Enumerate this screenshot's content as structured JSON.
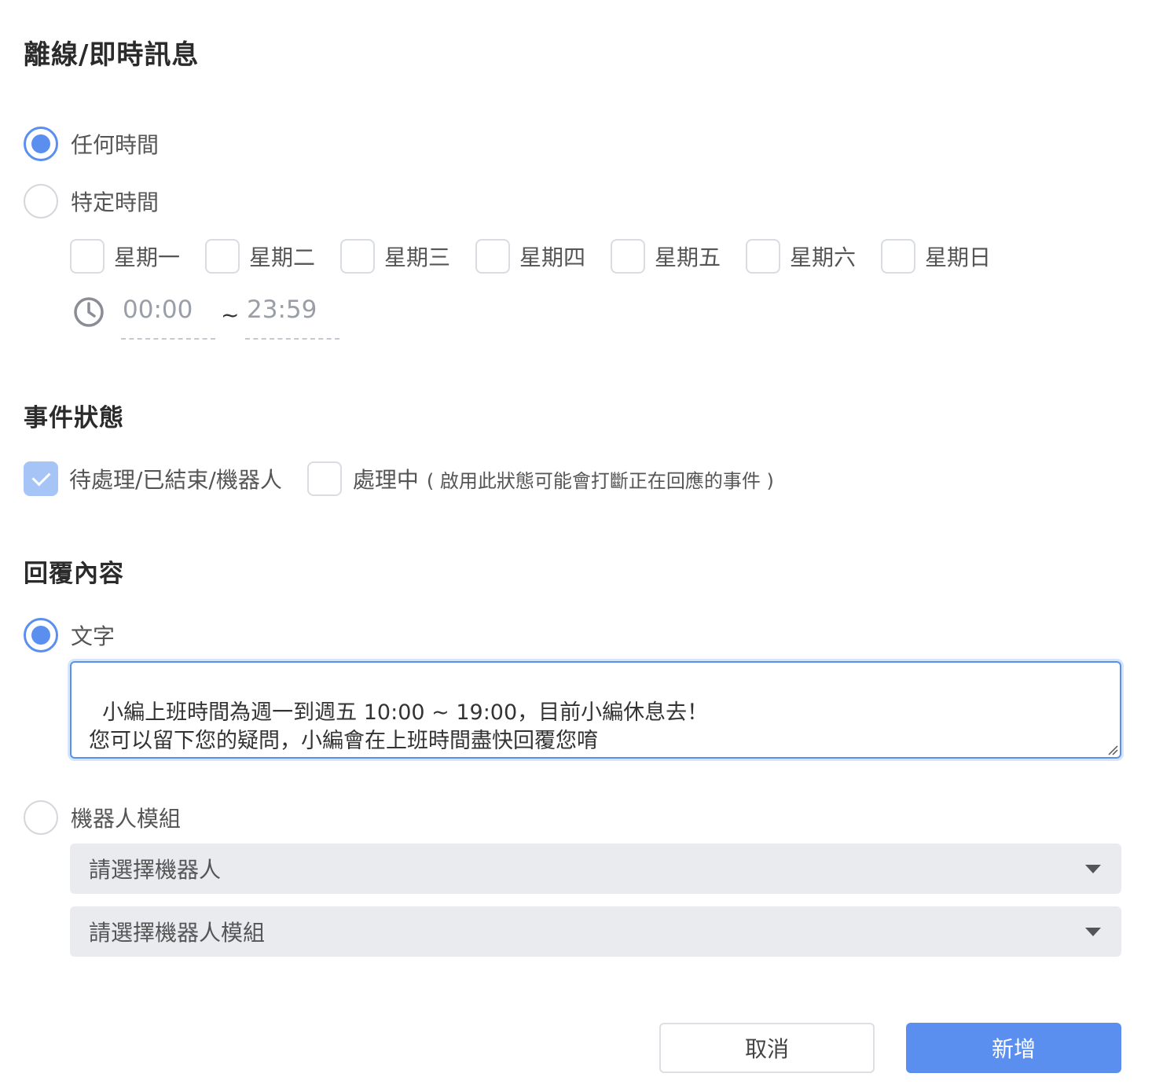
{
  "title": "離線/即時訊息",
  "schedule": {
    "any_time_label": "任何時間",
    "specific_time_label": "特定時間",
    "days": [
      "星期一",
      "星期二",
      "星期三",
      "星期四",
      "星期五",
      "星期六",
      "星期日"
    ],
    "start_time": "00:00",
    "separator": "~",
    "end_time": "23:59"
  },
  "event_status": {
    "heading": "事件狀態",
    "option1_label": "待處理/已結束/機器人",
    "option2_label": "處理中",
    "option2_note": "( 啟用此狀態可能會打斷正在回應的事件 )"
  },
  "reply": {
    "heading": "回覆內容",
    "text_option_label": "文字",
    "text_value": "小編上班時間為週一到週五 10:00 ~ 19:00，目前小編休息去！\n您可以留下您的疑問，小編會在上班時間盡快回覆您唷",
    "bot_option_label": "機器人模組",
    "bot_select_placeholder": "請選擇機器人",
    "bot_module_select_placeholder": "請選擇機器人模組"
  },
  "actions": {
    "cancel_label": "取消",
    "add_label": "新增"
  },
  "colors": {
    "accent": "#5a8ff0",
    "checkbox_checked_disabled": "#a7c4f6",
    "select_background": "#e9ebef"
  },
  "icons": {
    "time": "clock-icon",
    "select": "caret-down-icon"
  }
}
